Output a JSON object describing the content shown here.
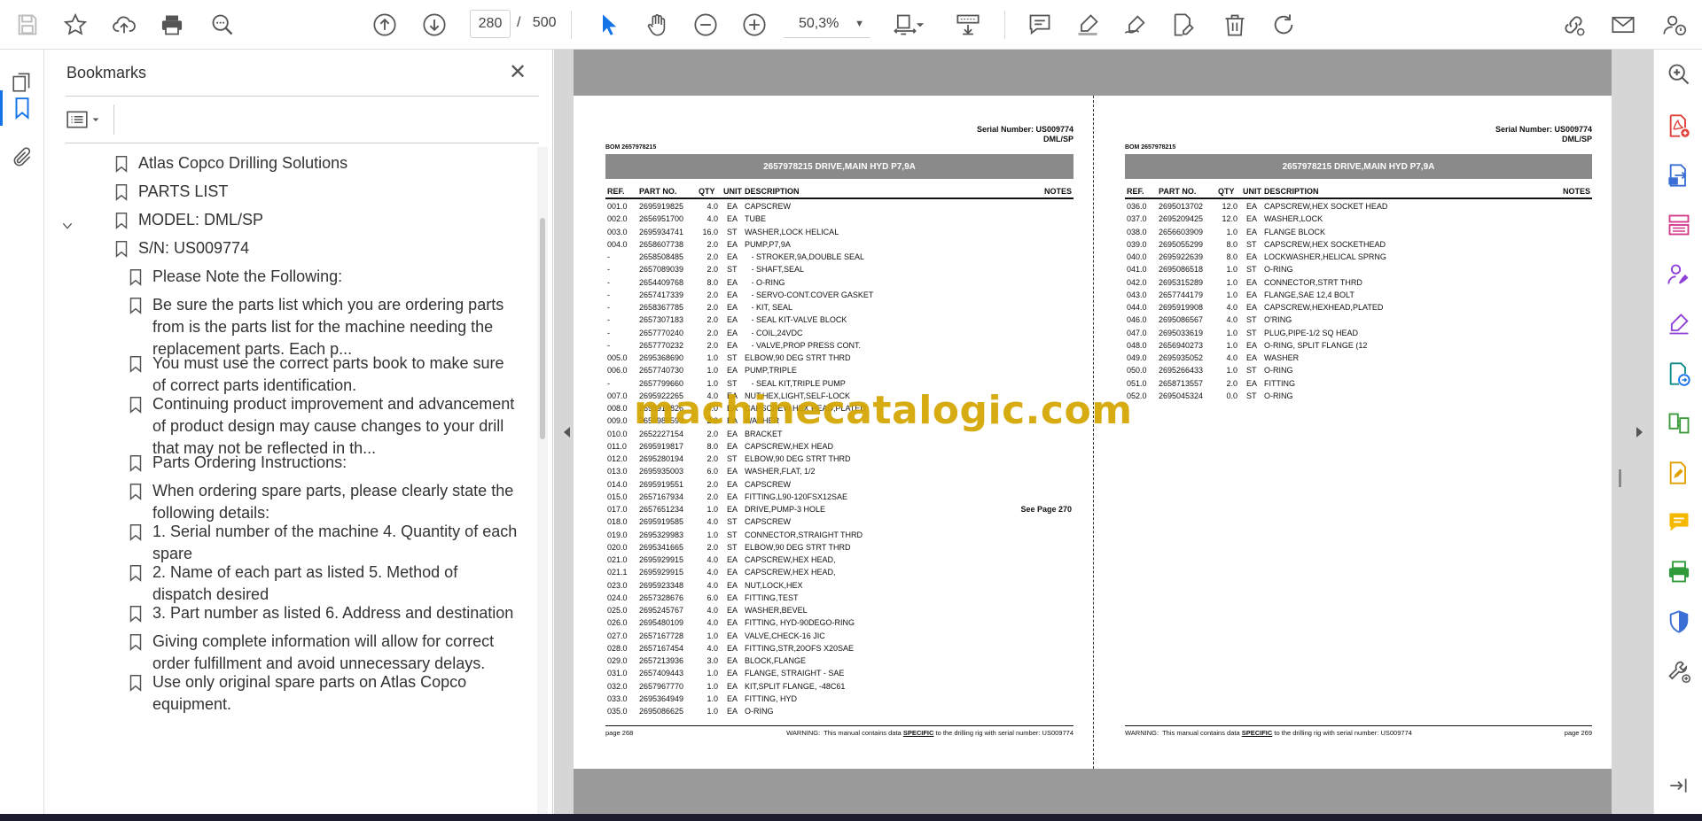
{
  "toolbar": {
    "current_page": "280",
    "page_separator": "/",
    "total_pages": "500",
    "zoom": "50,3%"
  },
  "bookmarks": {
    "title": "Bookmarks",
    "items": [
      {
        "label": "Atlas Copco Drilling Solutions"
      },
      {
        "label": "PARTS LIST"
      },
      {
        "label": "MODEL: DML/SP"
      },
      {
        "label": "S/N: US009774"
      },
      {
        "label": "Please Note the Following:"
      },
      {
        "label": "Be sure the parts list which you are ordering parts from is the parts list for the machine needing the replacement parts. Each p..."
      },
      {
        "label": "You must use the correct parts book to make sure of correct parts identification."
      },
      {
        "label": "Continuing product improvement and advancement of product design may cause changes to your drill that may not be reflected in th..."
      },
      {
        "label": "Parts Ordering Instructions:"
      },
      {
        "label": "When ordering spare parts, please clearly state the following details:"
      },
      {
        "label": "1. Serial number of the machine 4. Quantity of each spare"
      },
      {
        "label": "2. Name of each part as listed 5. Method of dispatch desired"
      },
      {
        "label": "3. Part number as listed 6. Address and destination"
      },
      {
        "label": "Giving complete information will allow for correct order fulfillment and avoid unnecessary delays."
      },
      {
        "label": "Use only original spare parts on Atlas Copco equipment."
      }
    ]
  },
  "watermark": "machinecatalogic.com",
  "left_page": {
    "serial": "Serial Number: US009774",
    "model": "DML/SP",
    "bom": "BOM 2657978215",
    "title": "2657978215 DRIVE,MAIN HYD P7,9A",
    "columns": {
      "ref": "REF.",
      "part": "PART NO.",
      "qty": "QTY",
      "unit": "UNIT",
      "desc": "DESCRIPTION",
      "notes": "NOTES"
    },
    "rows": [
      {
        "ref": "001.0",
        "part": "2695919825",
        "qty": "4.0",
        "unit": "EA",
        "desc": "CAPSCREW",
        "notes": ""
      },
      {
        "ref": "002.0",
        "part": "2656951700",
        "qty": "4.0",
        "unit": "EA",
        "desc": "TUBE",
        "notes": ""
      },
      {
        "ref": "003.0",
        "part": "2695934741",
        "qty": "16.0",
        "unit": "ST",
        "desc": "WASHER,LOCK HELICAL",
        "notes": ""
      },
      {
        "ref": "004.0",
        "part": "2658607738",
        "qty": "2.0",
        "unit": "EA",
        "desc": "PUMP,P7,9A",
        "notes": ""
      },
      {
        "ref": "-",
        "part": "2658508485",
        "qty": "2.0",
        "unit": "EA",
        "desc": "   - STROKER,9A,DOUBLE SEAL",
        "notes": ""
      },
      {
        "ref": "-",
        "part": "2657089039",
        "qty": "2.0",
        "unit": "ST",
        "desc": "   - SHAFT,SEAL",
        "notes": ""
      },
      {
        "ref": "-",
        "part": "2654409768",
        "qty": "8.0",
        "unit": "EA",
        "desc": "   - O-RING",
        "notes": ""
      },
      {
        "ref": "-",
        "part": "2657417339",
        "qty": "2.0",
        "unit": "EA",
        "desc": "   - SERVO-CONT.COVER GASKET",
        "notes": ""
      },
      {
        "ref": "-",
        "part": "2658367785",
        "qty": "2.0",
        "unit": "EA",
        "desc": "   - KIT, SEAL",
        "notes": ""
      },
      {
        "ref": "-",
        "part": "2657307183",
        "qty": "2.0",
        "unit": "EA",
        "desc": "   - SEAL KIT-VALVE BLOCK",
        "notes": ""
      },
      {
        "ref": "-",
        "part": "2657770240",
        "qty": "2.0",
        "unit": "EA",
        "desc": "   - COIL,24VDC",
        "notes": ""
      },
      {
        "ref": "-",
        "part": "2657770232",
        "qty": "2.0",
        "unit": "EA",
        "desc": "   - VALVE,PROP PRESS CONT.",
        "notes": ""
      },
      {
        "ref": "005.0",
        "part": "2695368690",
        "qty": "1.0",
        "unit": "ST",
        "desc": "ELBOW,90 DEG STRT THRD",
        "notes": ""
      },
      {
        "ref": "006.0",
        "part": "2657740730",
        "qty": "1.0",
        "unit": "EA",
        "desc": "PUMP,TRIPLE",
        "notes": ""
      },
      {
        "ref": "-",
        "part": "2657799660",
        "qty": "1.0",
        "unit": "ST",
        "desc": "   - SEAL KIT,TRIPLE PUMP",
        "notes": ""
      },
      {
        "ref": "007.0",
        "part": "2695922265",
        "qty": "4.0",
        "unit": "EA",
        "desc": "NUT,HEX,LIGHT,SELF-LOCK",
        "notes": ""
      },
      {
        "ref": "008.0",
        "part": "2695919826",
        "qty": "4.0",
        "unit": "EA",
        "desc": "CAPSCREW,HEX HEAD,PLATED",
        "notes": ""
      },
      {
        "ref": "009.0",
        "part": "2656986599",
        "qty": "2.0",
        "unit": "EA",
        "desc": "WASHER",
        "notes": ""
      },
      {
        "ref": "010.0",
        "part": "2652227154",
        "qty": "2.0",
        "unit": "EA",
        "desc": "BRACKET",
        "notes": ""
      },
      {
        "ref": "011.0",
        "part": "2695919817",
        "qty": "8.0",
        "unit": "EA",
        "desc": "CAPSCREW,HEX HEAD",
        "notes": ""
      },
      {
        "ref": "012.0",
        "part": "2695280194",
        "qty": "2.0",
        "unit": "ST",
        "desc": "ELBOW,90 DEG STRT THRD",
        "notes": ""
      },
      {
        "ref": "013.0",
        "part": "2695935003",
        "qty": "6.0",
        "unit": "EA",
        "desc": "WASHER,FLAT, 1/2",
        "notes": ""
      },
      {
        "ref": "014.0",
        "part": "2695919551",
        "qty": "2.0",
        "unit": "EA",
        "desc": "CAPSCREW",
        "notes": ""
      },
      {
        "ref": "015.0",
        "part": "2657167934",
        "qty": "2.0",
        "unit": "EA",
        "desc": "FITTING,L90-120FSX12SAE",
        "notes": ""
      },
      {
        "ref": "017.0",
        "part": "2657651234",
        "qty": "1.0",
        "unit": "EA",
        "desc": "DRIVE,PUMP-3 HOLE",
        "notes": "See Page 270"
      },
      {
        "ref": "018.0",
        "part": "2695919585",
        "qty": "4.0",
        "unit": "ST",
        "desc": "CAPSCREW",
        "notes": ""
      },
      {
        "ref": "019.0",
        "part": "2695329983",
        "qty": "1.0",
        "unit": "ST",
        "desc": "CONNECTOR,STRAIGHT THRD",
        "notes": ""
      },
      {
        "ref": "020.0",
        "part": "2695341665",
        "qty": "2.0",
        "unit": "ST",
        "desc": "ELBOW,90 DEG STRT THRD",
        "notes": ""
      },
      {
        "ref": "021.0",
        "part": "2695929915",
        "qty": "4.0",
        "unit": "EA",
        "desc": "CAPSCREW,HEX HEAD,",
        "notes": ""
      },
      {
        "ref": "021.1",
        "part": "2695929915",
        "qty": "4.0",
        "unit": "EA",
        "desc": "CAPSCREW,HEX HEAD,",
        "notes": ""
      },
      {
        "ref": "023.0",
        "part": "2695923348",
        "qty": "4.0",
        "unit": "EA",
        "desc": "NUT,LOCK,HEX",
        "notes": ""
      },
      {
        "ref": "024.0",
        "part": "2657328676",
        "qty": "6.0",
        "unit": "EA",
        "desc": "FITTING,TEST",
        "notes": ""
      },
      {
        "ref": "025.0",
        "part": "2695245767",
        "qty": "4.0",
        "unit": "EA",
        "desc": "WASHER,BEVEL",
        "notes": ""
      },
      {
        "ref": "026.0",
        "part": "2695480109",
        "qty": "4.0",
        "unit": "EA",
        "desc": "FITTING, HYD-90DEGO-RING",
        "notes": ""
      },
      {
        "ref": "027.0",
        "part": "2657167728",
        "qty": "1.0",
        "unit": "EA",
        "desc": "VALVE,CHECK-16 JIC",
        "notes": ""
      },
      {
        "ref": "028.0",
        "part": "2657167454",
        "qty": "4.0",
        "unit": "EA",
        "desc": "FITTING,STR,20OFS X20SAE",
        "notes": ""
      },
      {
        "ref": "029.0",
        "part": "2657213936",
        "qty": "3.0",
        "unit": "EA",
        "desc": "BLOCK,FLANGE",
        "notes": ""
      },
      {
        "ref": "031.0",
        "part": "2657409443",
        "qty": "1.0",
        "unit": "EA",
        "desc": "FLANGE, STRAIGHT - SAE",
        "notes": ""
      },
      {
        "ref": "032.0",
        "part": "2657967770",
        "qty": "1.0",
        "unit": "EA",
        "desc": "KIT,SPLIT FLANGE, -48C61",
        "notes": ""
      },
      {
        "ref": "033.0",
        "part": "2695364949",
        "qty": "1.0",
        "unit": "EA",
        "desc": "FITTING, HYD",
        "notes": ""
      },
      {
        "ref": "035.0",
        "part": "2695086625",
        "qty": "1.0",
        "unit": "EA",
        "desc": "O-RING",
        "notes": ""
      }
    ],
    "page_label": "page 268",
    "warning_a": "WARNING:  This manual contains data ",
    "warning_b": "SPECIFIC",
    "warning_c": " to the drilling rig with serial number: US009774"
  },
  "right_page": {
    "serial": "Serial Number: US009774",
    "model": "DML/SP",
    "bom": "BOM 2657978215",
    "title": "2657978215 DRIVE,MAIN HYD P7,9A",
    "columns": {
      "ref": "REF.",
      "part": "PART NO.",
      "qty": "QTY",
      "unit": "UNIT",
      "desc": "DESCRIPTION",
      "notes": "NOTES"
    },
    "rows": [
      {
        "ref": "036.0",
        "part": "2695013702",
        "qty": "12.0",
        "unit": "EA",
        "desc": "CAPSCREW,HEX SOCKET HEAD",
        "notes": ""
      },
      {
        "ref": "037.0",
        "part": "2695209425",
        "qty": "12.0",
        "unit": "EA",
        "desc": "WASHER,LOCK",
        "notes": ""
      },
      {
        "ref": "038.0",
        "part": "2656603909",
        "qty": "1.0",
        "unit": "EA",
        "desc": "FLANGE BLOCK",
        "notes": ""
      },
      {
        "ref": "039.0",
        "part": "2695055299",
        "qty": "8.0",
        "unit": "ST",
        "desc": "CAPSCREW,HEX SOCKETHEAD",
        "notes": ""
      },
      {
        "ref": "040.0",
        "part": "2695922639",
        "qty": "8.0",
        "unit": "EA",
        "desc": "LOCKWASHER,HELICAL SPRNG",
        "notes": ""
      },
      {
        "ref": "041.0",
        "part": "2695086518",
        "qty": "1.0",
        "unit": "ST",
        "desc": "O-RING",
        "notes": ""
      },
      {
        "ref": "042.0",
        "part": "2695315289",
        "qty": "1.0",
        "unit": "EA",
        "desc": "CONNECTOR,STRT THRD",
        "notes": ""
      },
      {
        "ref": "043.0",
        "part": "2657744179",
        "qty": "1.0",
        "unit": "EA",
        "desc": "FLANGE,SAE 12,4 BOLT",
        "notes": ""
      },
      {
        "ref": "044.0",
        "part": "2695919908",
        "qty": "4.0",
        "unit": "EA",
        "desc": "CAPSCREW,HEXHEAD,PLATED",
        "notes": ""
      },
      {
        "ref": "046.0",
        "part": "2695086567",
        "qty": "4.0",
        "unit": "ST",
        "desc": "O'RING",
        "notes": ""
      },
      {
        "ref": "047.0",
        "part": "2695033619",
        "qty": "1.0",
        "unit": "ST",
        "desc": "PLUG,PIPE-1/2 SQ HEAD",
        "notes": ""
      },
      {
        "ref": "048.0",
        "part": "2656940273",
        "qty": "1.0",
        "unit": "EA",
        "desc": "O-RING, SPLIT FLANGE (12",
        "notes": ""
      },
      {
        "ref": "049.0",
        "part": "2695935052",
        "qty": "4.0",
        "unit": "EA",
        "desc": "WASHER",
        "notes": ""
      },
      {
        "ref": "050.0",
        "part": "2695266433",
        "qty": "1.0",
        "unit": "ST",
        "desc": "O-RING",
        "notes": ""
      },
      {
        "ref": "051.0",
        "part": "2658713557",
        "qty": "2.0",
        "unit": "EA",
        "desc": "FITTING",
        "notes": ""
      },
      {
        "ref": "052.0",
        "part": "2695045324",
        "qty": "0.0",
        "unit": "ST",
        "desc": "O-RING",
        "notes": ""
      }
    ],
    "page_label": "page 269",
    "warning_a": "WARNING:  This manual contains data ",
    "warning_b": "SPECIFIC",
    "warning_c": " to the drilling rig with serial number: US009774"
  }
}
